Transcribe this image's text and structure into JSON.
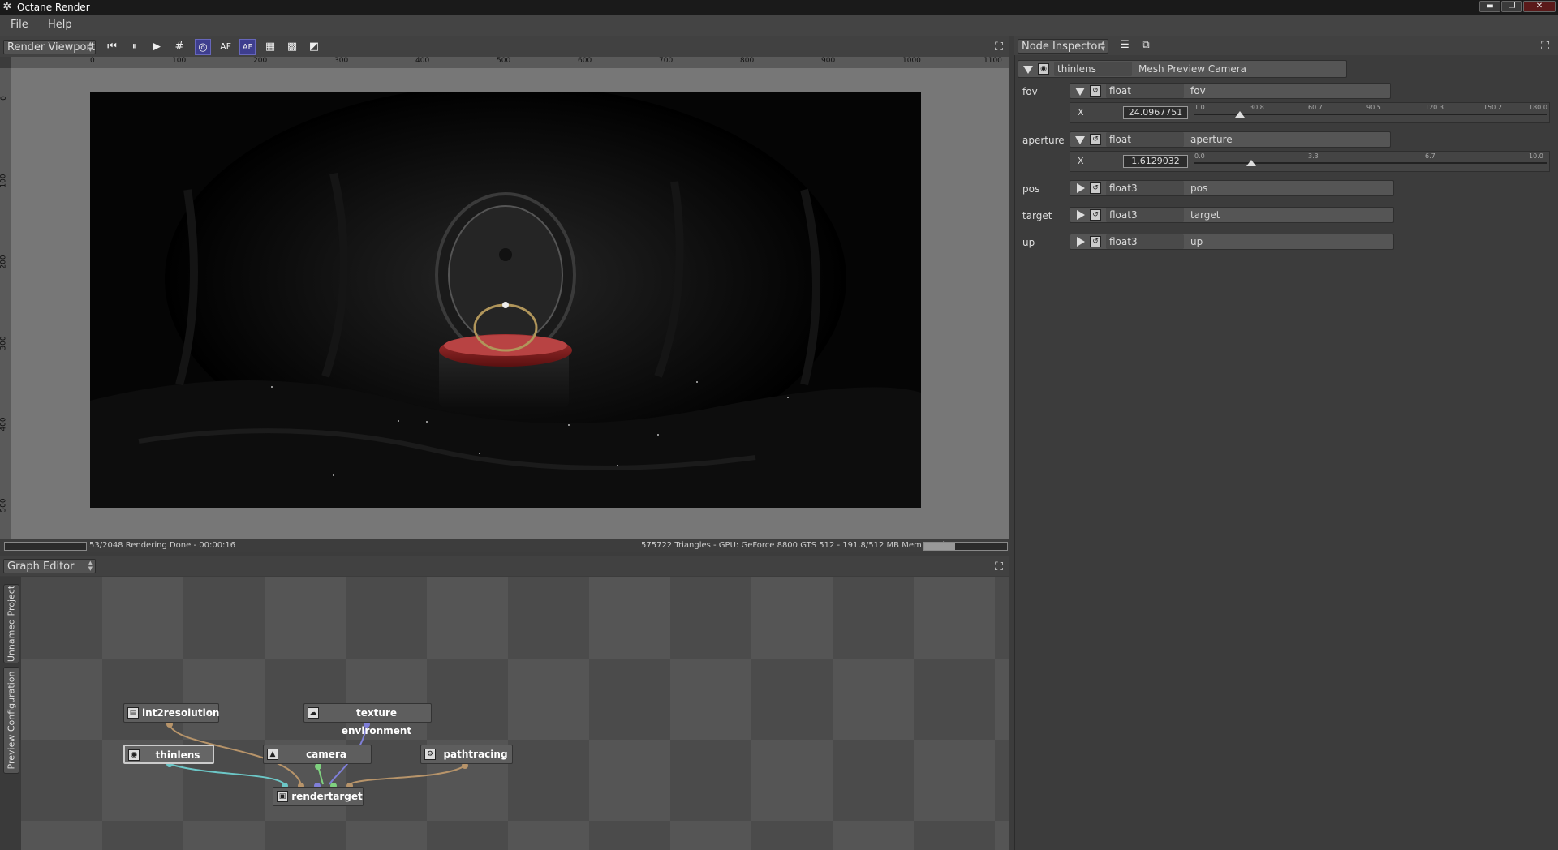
{
  "window": {
    "title": "Octane Render",
    "minimize": "▬",
    "restore": "❐",
    "close": "✕"
  },
  "menu": [
    "File",
    "Help"
  ],
  "viewport": {
    "panel_name": "Render Viewport",
    "toolbar_icons": [
      "skip-back-icon",
      "pause-icon",
      "play-icon",
      "grid-icon",
      "focus-picker-icon",
      "autofocus-icon",
      "autofocus-picker-icon",
      "region-icon",
      "checker-icon",
      "alpha-icon"
    ],
    "ruler_h": [
      "0",
      "100",
      "200",
      "300",
      "400",
      "500",
      "600",
      "700",
      "800",
      "900",
      "1000",
      "1100"
    ],
    "ruler_v": [
      "0",
      "100",
      "200",
      "300",
      "400",
      "500"
    ]
  },
  "status": {
    "progress_text": "53/2048 Rendering Done - 00:00:16",
    "info_text": "575722 Triangles - GPU: GeForce 8800 GTS 512 - 191.8/512 MB Mem Used",
    "mem_fraction": 0.37
  },
  "graph_editor": {
    "panel_name": "Graph Editor",
    "tabs": [
      "Unnamed Project",
      "Preview Configuration"
    ],
    "nodes": {
      "int2resolution": "int2resolution",
      "texture_environment": "texture environment",
      "thinlens": "thinlens",
      "camera": "camera",
      "pathtracing": "pathtracing",
      "rendertarget": "rendertarget"
    }
  },
  "inspector": {
    "panel_name": "Node Inspector",
    "node_type": "thinlens",
    "node_name": "Mesh Preview Camera",
    "params": [
      {
        "label": "fov",
        "type": "float",
        "name": "fov",
        "axis": "X",
        "value": "24.0967751",
        "ticks": [
          "1.0",
          "30.8",
          "60.7",
          "90.5",
          "120.3",
          "150.2",
          "180.0"
        ],
        "fraction": 0.128
      },
      {
        "label": "aperture",
        "type": "float",
        "name": "aperture",
        "axis": "X",
        "value": "1.6129032",
        "ticks": [
          "0.0",
          "3.3",
          "6.7",
          "10.0"
        ],
        "fraction": 0.161
      }
    ],
    "collapsed": [
      {
        "label": "pos",
        "type": "float3",
        "name": "pos"
      },
      {
        "label": "target",
        "type": "float3",
        "name": "target"
      },
      {
        "label": "up",
        "type": "float3",
        "name": "up"
      }
    ]
  }
}
